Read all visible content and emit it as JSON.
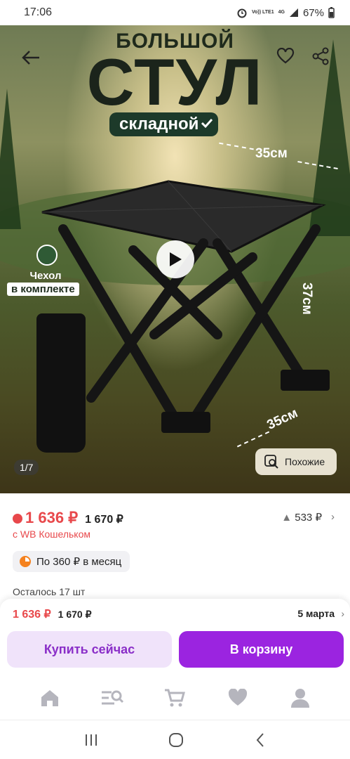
{
  "status": {
    "time": "17:06",
    "net_top": "Vo)) LTE1",
    "net_4g": "4G",
    "battery": "67%"
  },
  "hero": {
    "headline_top": "БОЛЬШОЙ",
    "headline_big": "СТУЛ",
    "headline_badge": "складной",
    "dim_top": "35см",
    "dim_right": "37см",
    "dim_bottom": "35см",
    "cover_line1": "Чехол",
    "cover_line2": "в комплекте",
    "counter": "1/7",
    "similar_label": "Похожие"
  },
  "product": {
    "price": "1 636 ₽",
    "old_price": "1 670 ₽",
    "change": "533 ₽",
    "wallet": "с WB Кошельком",
    "installment": "По 360 ₽ в месяц",
    "stock": "Осталось 17 шт"
  },
  "sheet": {
    "price": "1 636 ₽",
    "old_price": "1 670 ₽",
    "delivery": "5 марта",
    "buy_now": "Купить сейчас",
    "to_cart": "В корзину"
  },
  "colors": {
    "accent": "#9b24e0",
    "price": "#e8484b",
    "buy_bg": "#f0e3fa"
  }
}
